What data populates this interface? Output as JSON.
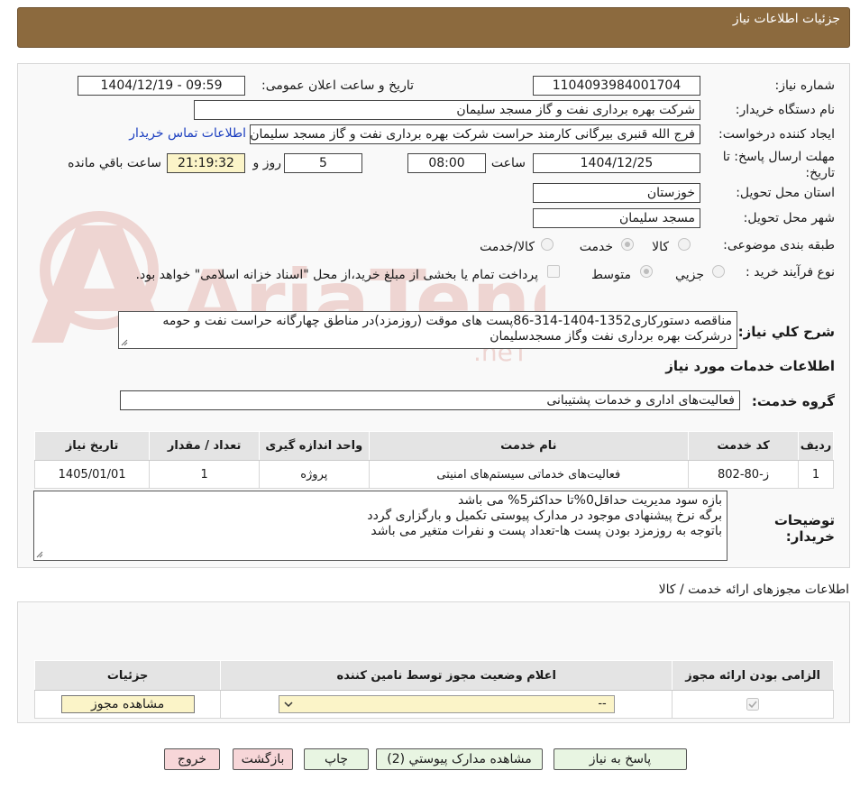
{
  "header": {
    "title": "جزئیات اطلاعات نیاز"
  },
  "fields": {
    "need_number_label": "شماره نیاز:",
    "need_number": "1104093984001704",
    "announce_label": "تاریخ و ساعت اعلان عمومی:",
    "announce_value": "1404/12/19 - 09:59",
    "buyer_org_label": "نام دستگاه خریدار:",
    "buyer_org": "شرکت بهره برداری نفت و گاز مسجد سلیمان",
    "requester_label": "ایجاد کننده درخواست:",
    "requester": "فرج الله قنبری بیرگانی کارمند حراست شرکت بهره برداری نفت و گاز مسجد سلیمان",
    "contact_link": "اطلاعات تماس خریدار",
    "deadline_label_1": "مهلت ارسال پاسخ: تا",
    "deadline_label_2": "تاریخ:",
    "deadline_date": "1404/12/25",
    "time_label": "ساعت",
    "deadline_time": "08:00",
    "days_value": "5",
    "days_label": "روز و",
    "remaining_time": "21:19:32",
    "remaining_label": "ساعت باقي مانده",
    "province_label": "استان محل تحویل:",
    "province": "خوزستان",
    "city_label": "شهر محل تحویل:",
    "city": "مسجد سلیمان",
    "category_label": "طبقه بندی موضوعی:",
    "category_options": [
      "کالا",
      "خدمت",
      "کالا/خدمت"
    ],
    "category_selected": "خدمت",
    "process_label": "نوع فرآیند خرید :",
    "process_options": [
      "جزيي",
      "متوسط"
    ],
    "process_selected": "متوسط",
    "payment_note": "پرداخت تمام یا بخشی از مبلغ خرید،از محل \"اسناد خزانه اسلامی\" خواهد بود."
  },
  "description": {
    "label": "شرح کلي نیاز:",
    "line1": "مناقصه دستورکاری1352-1404-314-86پست های موقت (روزمزد)در مناطق چهارگانه حراست نفت و حومه",
    "line2": "درشرکت بهره برداری نفت وگاز مسجدسلیمان"
  },
  "services": {
    "section_title": "اطلاعات خدمات مورد نیاز",
    "group_label": "گروه خدمت:",
    "group_value": "فعالیت‌های اداری و خدمات پشتیبانی",
    "columns": [
      "ردیف",
      "کد خدمت",
      "نام خدمت",
      "واحد اندازه گیری",
      "تعداد / مقدار",
      "تاریخ نیاز"
    ],
    "rows": [
      [
        "1",
        "ز-80-802",
        "فعالیت‌های خدماتی سیستم‌های امنیتی",
        "پروژه",
        "1",
        "1405/01/01"
      ]
    ]
  },
  "buyer_notes": {
    "label_1": "توضیحات",
    "label_2": "خریدار:",
    "lines": [
      "بازه سود مدیریت حداقل0%تا حداکثر5% می باشد",
      "برگه نرخ پیشنهادی موجود در مدارک پیوستی تکمیل و بارگزاری گردد",
      "باتوجه به روزمزد بودن پست ها-تعداد پست و نفرات متغیر می باشد"
    ]
  },
  "licenses": {
    "section_title": "اطلاعات مجوزهای ارائه خدمت / کالا",
    "columns": [
      "الزامی بودن ارائه مجوز",
      "اعلام وضعیت مجوز توسط نامین کننده",
      "جزئیات"
    ],
    "select_value": "--",
    "view_button": "مشاهده مجوز"
  },
  "buttons": {
    "reply": "پاسخ به نیاز",
    "attachments": "مشاهده مدارک پیوستي (2)",
    "print": "چاپ",
    "back": "بازگشت",
    "exit": "خروج"
  },
  "colors": {
    "header_bg": "#8c6a3e",
    "link": "#1a3dbf",
    "highlight_yellow": "#fbf4c8",
    "button_green": "#e8f5e2",
    "button_pink": "#f7d6d8"
  }
}
